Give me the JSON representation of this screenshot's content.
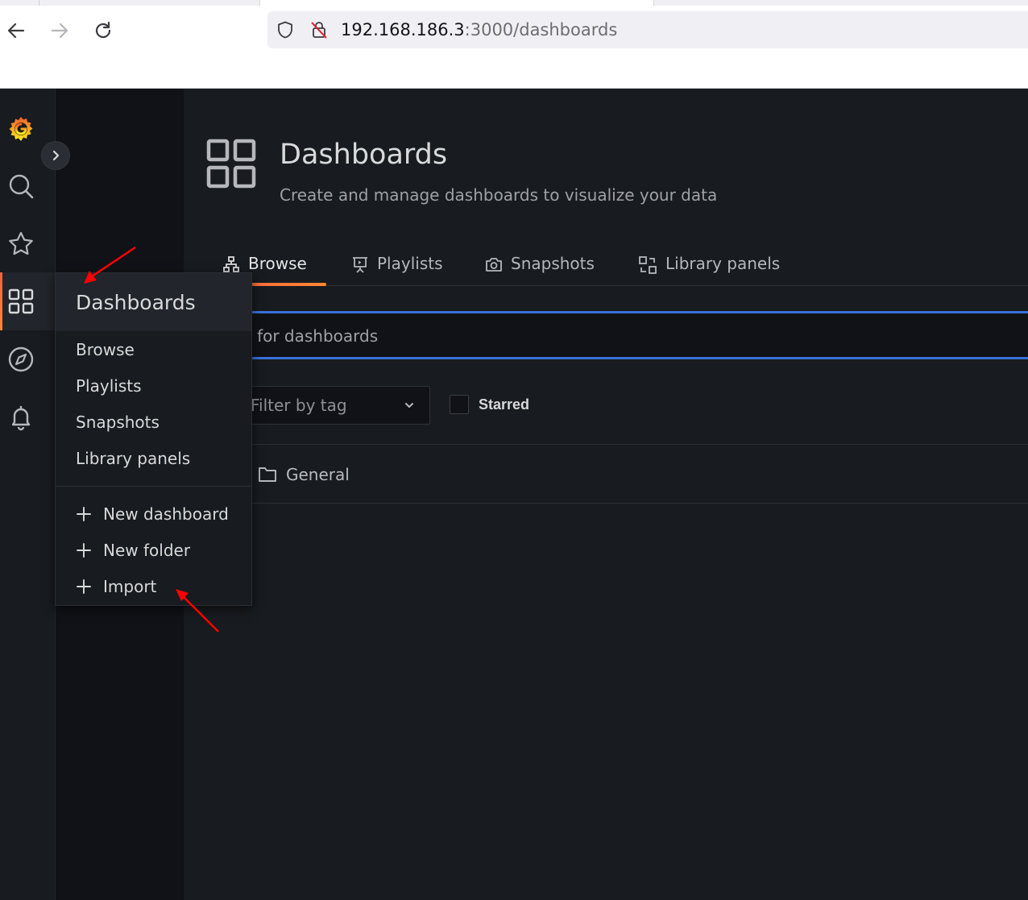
{
  "browser": {
    "url_host": "192.168.186.3",
    "url_path": ":3000/dashboards"
  },
  "sidemenu": {
    "items": [
      {
        "icon": "grafana-logo-icon"
      },
      {
        "icon": "search-icon"
      },
      {
        "icon": "star-icon"
      },
      {
        "icon": "apps-icon"
      },
      {
        "icon": "compass-icon"
      },
      {
        "icon": "bell-icon"
      }
    ]
  },
  "page": {
    "title": "Dashboards",
    "subtitle": "Create and manage dashboards to visualize your data"
  },
  "tabs": [
    {
      "label": "Browse",
      "icon": "sitemap-icon",
      "active": true
    },
    {
      "label": "Playlists",
      "icon": "presentation-icon",
      "active": false
    },
    {
      "label": "Snapshots",
      "icon": "camera-icon",
      "active": false
    },
    {
      "label": "Library panels",
      "icon": "library-panel-icon",
      "active": false
    }
  ],
  "search": {
    "placeholder": "Search for dashboards"
  },
  "filters": {
    "tag_placeholder": "Filter by tag",
    "starred_label": "Starred"
  },
  "folders": [
    {
      "label": "General"
    }
  ],
  "popup": {
    "title": "Dashboards",
    "items": [
      "Browse",
      "Playlists",
      "Snapshots",
      "Library panels"
    ],
    "actions": [
      "New dashboard",
      "New folder",
      "Import"
    ]
  },
  "colors": {
    "accent_orange": "#f55f3e",
    "accent_blue": "#3871dc",
    "annotation_red": "#ff0000",
    "background": "#181b1f"
  }
}
